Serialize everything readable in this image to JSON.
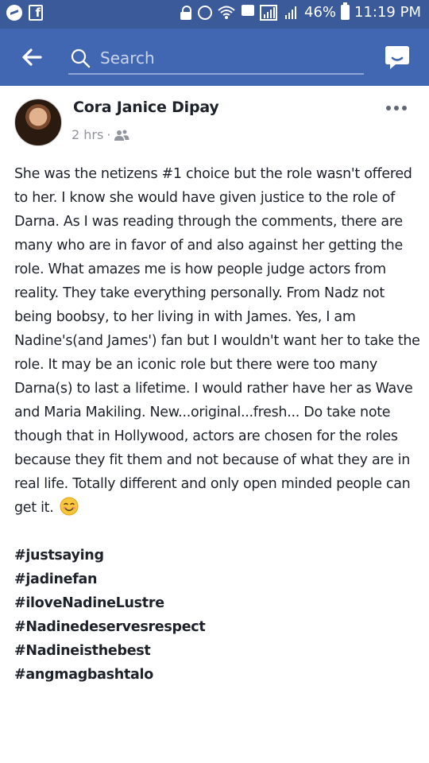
{
  "status_bar": {
    "battery": "46%",
    "time": "11:19 PM",
    "icons": [
      "messenger-icon",
      "facebook-icon",
      "lock-icon",
      "alarm-icon",
      "wifi-icon",
      "signal-icon",
      "signal-icon",
      "battery-icon"
    ]
  },
  "nav": {
    "search_placeholder": "Search",
    "icons": [
      "back-arrow-icon",
      "search-icon",
      "messenger-icon"
    ]
  },
  "post": {
    "author": "Cora Janice Dipay",
    "time": "2 hrs",
    "separator": "·",
    "privacy_icon": "friends-icon",
    "body": "She was the netizens #1 choice but the role wasn't offered to her. I know she would have given justice to the role of Darna. As I was reading through the comments, there are many who are in favor of and also against her getting the role. What amazes me is how people judge actors from reality. They take everything personally. From Nadz not being boobsy, to her living in with James. Yes, I am Nadine's(and James') fan but I wouldn't want her to take the role. It may be an iconic role but there were too many Darna(s) to last a lifetime. I would rather have her as Wave and Maria Makiling. New...original...fresh... Do take note though that in Hollywood, actors are chosen for the roles because they fit them and  not because of what they are in real life. Totally different and only open minded people can get it.",
    "emoji": "smiling-face-emoji",
    "hashtags": [
      "#justsaying",
      "#jadinefan",
      "#iloveNadineLustre",
      "#Nadinedeservesrespect",
      "#Nadineisthebest",
      "#angmagbashtalo"
    ]
  },
  "colors": {
    "status_bar": "#3b5a99",
    "nav_bar": "#4267b2",
    "text": "#1d2129",
    "meta": "#90949c"
  }
}
